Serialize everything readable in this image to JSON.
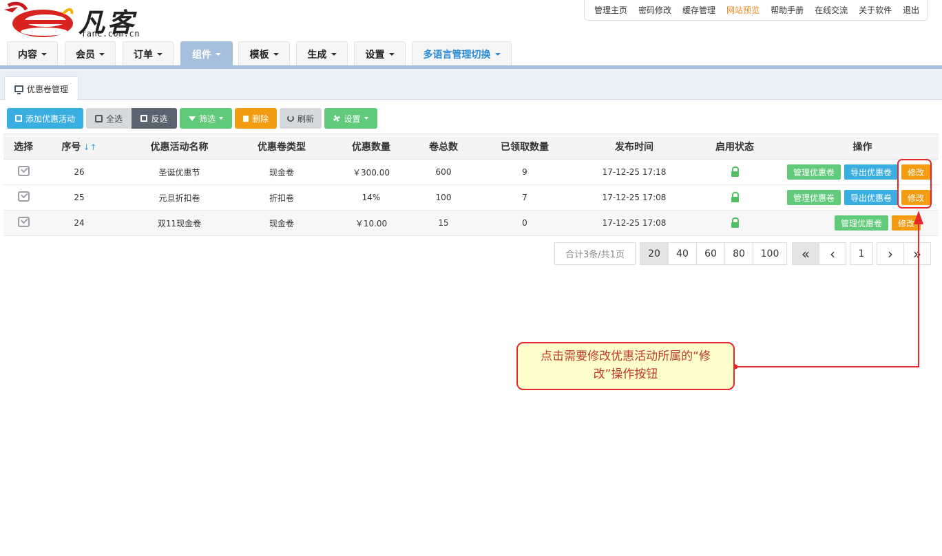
{
  "logo": {
    "brand_chars": "凡客",
    "domain_text": "fanc.com.cn"
  },
  "top_nav": [
    {
      "label": "管理主页",
      "highlight": false
    },
    {
      "label": "密码修改",
      "highlight": false
    },
    {
      "label": "缓存管理",
      "highlight": false
    },
    {
      "label": "网站预览",
      "highlight": true
    },
    {
      "label": "帮助手册",
      "highlight": false
    },
    {
      "label": "在线交流",
      "highlight": false
    },
    {
      "label": "关于软件",
      "highlight": false
    },
    {
      "label": "退出",
      "highlight": false
    }
  ],
  "main_nav": [
    {
      "label": "内容",
      "active": false
    },
    {
      "label": "会员",
      "active": false
    },
    {
      "label": "订单",
      "active": false
    },
    {
      "label": "组件",
      "active": true
    },
    {
      "label": "模板",
      "active": false
    },
    {
      "label": "生成",
      "active": false
    },
    {
      "label": "设置",
      "active": false
    },
    {
      "label": "多语言管理切换",
      "active": false
    }
  ],
  "sub_tab": {
    "label": "优惠卷管理"
  },
  "toolbar": {
    "add": "添加优惠活动",
    "select_all": "全选",
    "invert": "反选",
    "filter": "筛选",
    "delete": "删除",
    "refresh": "刷新",
    "settings": "设置"
  },
  "table": {
    "headers": [
      "选择",
      "序号",
      "优惠活动名称",
      "优惠卷类型",
      "优惠数量",
      "卷总数",
      "已领取数量",
      "发布时间",
      "启用状态",
      "操作"
    ],
    "rows": [
      {
        "id": "26",
        "name": "圣诞优惠节",
        "type": "现金卷",
        "type_kind": "cash",
        "amount": "￥300.00",
        "total": "600",
        "claimed": "9",
        "time": "17-12-25 17:18",
        "status": "unlocked",
        "ops": [
          "管理优惠卷",
          "导出优惠卷",
          "修改"
        ]
      },
      {
        "id": "25",
        "name": "元旦折扣卷",
        "type": "折扣卷",
        "type_kind": "discount",
        "amount": "14%",
        "total": "100",
        "claimed": "7",
        "time": "17-12-25 17:08",
        "status": "unlocked",
        "ops": [
          "管理优惠卷",
          "导出优惠卷",
          "修改"
        ]
      },
      {
        "id": "24",
        "name": "双11现金卷",
        "type": "现金卷",
        "type_kind": "cash",
        "amount": "￥10.00",
        "total": "15",
        "claimed": "0",
        "time": "17-12-25 17:08",
        "status": "unlocked",
        "ops": [
          "管理优惠卷",
          "修改"
        ]
      }
    ]
  },
  "pagination": {
    "summary": "合计3条/共1页",
    "page_sizes": [
      "20",
      "40",
      "60",
      "80",
      "100"
    ],
    "selected_size": "20",
    "first": "«",
    "prev": "‹",
    "current": "1",
    "next": "›",
    "last": "»"
  },
  "annotation": {
    "text": "点击需要修改优惠活动所属的“修改”操作按钮"
  },
  "colors": {
    "accent_blue": "#3aaee0",
    "green": "#62cb7b",
    "orange": "#f39c12",
    "active_tab": "#a5bfdc",
    "annotation_red": "#e8262b",
    "annotation_bg": "#ffffcc"
  }
}
